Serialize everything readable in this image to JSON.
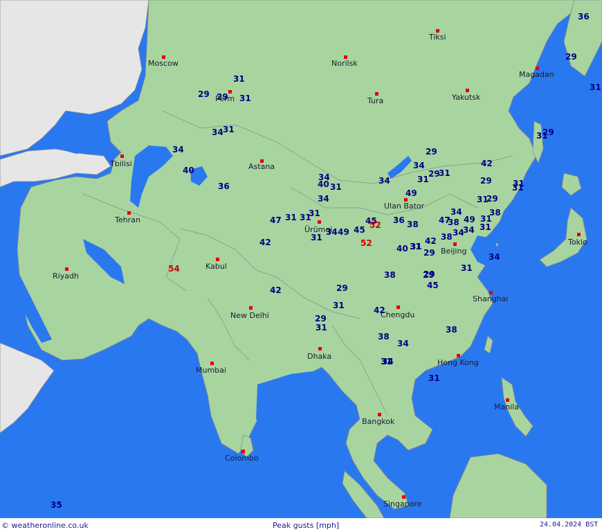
{
  "colors": {
    "ocean": "#2a78f0",
    "land": "#a8d4a0",
    "neighbor_land": "#e6e6e6",
    "border": "#8a8a8a",
    "normal_value": "#000080",
    "high_value": "#d00000",
    "city_marker": "#e00000"
  },
  "footer": {
    "credit": "© weatheronline.co.uk",
    "title": "Peak gusts [mph]",
    "date": "24.04.2024 BST"
  },
  "cities": [
    {
      "name": "Moscow"
    },
    {
      "name": "Norilsk"
    },
    {
      "name": "Tiksi"
    },
    {
      "name": "Magadan"
    },
    {
      "name": "Perm"
    },
    {
      "name": "Tura"
    },
    {
      "name": "Yakutsk"
    },
    {
      "name": "Tbilisi"
    },
    {
      "name": "Astana"
    },
    {
      "name": "Ulan Bator"
    },
    {
      "name": "Ürümqi"
    },
    {
      "name": "Tehran"
    },
    {
      "name": "Tokio"
    },
    {
      "name": "Beijing"
    },
    {
      "name": "Kabul"
    },
    {
      "name": "Riyadh"
    },
    {
      "name": "Shanghai"
    },
    {
      "name": "New Delhi"
    },
    {
      "name": "Chengdu"
    },
    {
      "name": "Dhaka"
    },
    {
      "name": "Hong Kong"
    },
    {
      "name": "Mumbai"
    },
    {
      "name": "Manila"
    },
    {
      "name": "Bangkok"
    },
    {
      "name": "Colombo"
    },
    {
      "name": "Singapore"
    }
  ],
  "gust_values": [
    "36",
    "29",
    "31",
    "29",
    "29",
    "31",
    "31",
    "29",
    "31",
    "34",
    "31",
    "34",
    "29",
    "42",
    "34",
    "29",
    "31",
    "31",
    "34",
    "40",
    "34",
    "40",
    "31",
    "31",
    "29",
    "49",
    "36",
    "34",
    "31",
    "29",
    "31",
    "38",
    "47",
    "31",
    "31",
    "31",
    "34",
    "31",
    "45",
    "52",
    "36",
    "38",
    "47",
    "38",
    "49",
    "31",
    "38",
    "34",
    "34",
    "49",
    "45",
    "42",
    "31",
    "52",
    "29",
    "34",
    "31",
    "42",
    "38",
    "40",
    "31",
    "42",
    "29",
    "29",
    "54",
    "31",
    "38",
    "29",
    "45",
    "34",
    "29",
    "31",
    "31",
    "42",
    "31",
    "34",
    "38",
    "34",
    "31",
    "35"
  ]
}
